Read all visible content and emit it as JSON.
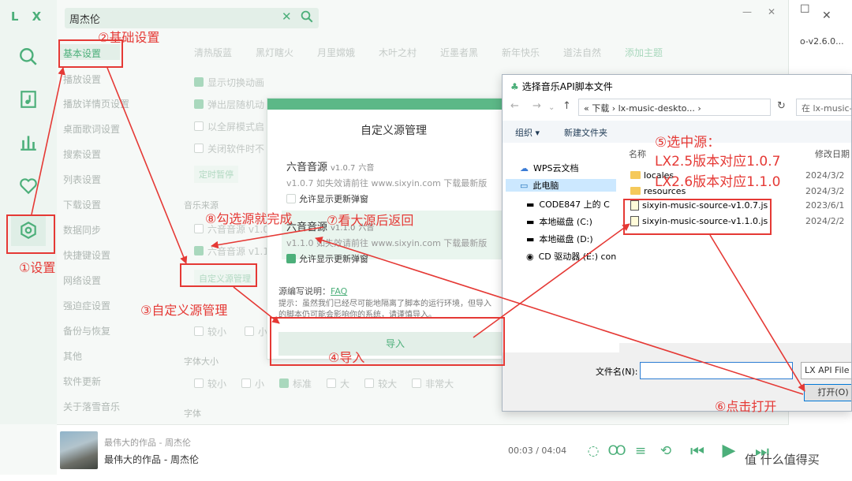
{
  "app": {
    "logo": "L X",
    "search": {
      "value": "周杰伦"
    },
    "window_controls": {
      "minimize": "—",
      "close": "✕"
    }
  },
  "settings_nav": {
    "items": [
      "基本设置",
      "播放设置",
      "播放详情页设置",
      "桌面歌词设置",
      "搜索设置",
      "列表设置",
      "下载设置",
      "数据同步",
      "快捷键设置",
      "网络设置",
      "强迫症设置",
      "备份与恢复",
      "其他",
      "软件更新",
      "关于落雪音乐"
    ]
  },
  "themes": [
    "清热版蓝",
    "黑灯瞎火",
    "月里嫦娥",
    "木叶之村",
    "近墨者黑",
    "新年快乐",
    "道法自然",
    "添加主题"
  ],
  "settings": {
    "show_animation": "显示切换动画",
    "popup_animation": "弹出层随机动",
    "fullscreen": "以全屏模式启",
    "close_tray": "关闭软件时不",
    "timer_pause": "定时暂停",
    "music_source_label": "音乐来源",
    "src_line1": "六音音源 v1.0",
    "src_line2": "六音音源 v1.1",
    "custom_source_btn": "自定义源管理",
    "size_small": "较小",
    "size_tiny": "小",
    "font_size_label": "字体大小",
    "font_opts": [
      "较小",
      "小",
      "标准",
      "大",
      "较大",
      "非常大"
    ],
    "font_label": "字体"
  },
  "player": {
    "track_sub": "最伟大的作品 - 周杰伦",
    "track_main": "最伟大的作品 - 周杰伦",
    "time": "00:03 / 04:04"
  },
  "custom_source_dialog": {
    "title": "自定义源管理",
    "sources": [
      {
        "name": "六音音源",
        "version": "v1.0.7",
        "author": "六音",
        "desc": "v1.0.7 如失效请前往 www.sixyin.com 下载最新版",
        "allow_update": "允许显示更新弹窗"
      },
      {
        "name": "六音音源",
        "version": "v1.1.0",
        "author": "六音",
        "desc": "v1.1.0 如失效请前往 www.sixyin.com 下载最新版",
        "allow_update": "允许显示更新弹窗"
      }
    ],
    "note_label": "源编写说明：",
    "note_link": "FAQ",
    "tip_line1": "提示：虽然我们已经尽可能地隔离了脚本的运行环境，但导入",
    "tip_line2": "的脚本仍可能会影响你的系统，请谨慎导入。",
    "import_label": "导入"
  },
  "file_dialog": {
    "title": "选择音乐API脚本文件",
    "address": "«  下载  ›  lx-music-deskto...  ›",
    "search_placeholder": "在 lx-music-desk",
    "organize": "组织 ▾",
    "new_folder": "新建文件夹",
    "tree": [
      "WPS云文档",
      "此电脑",
      "CODE847 上的 C",
      "本地磁盘 (C:)",
      "本地磁盘 (D:)",
      "CD 驱动器 (E:) con"
    ],
    "col_name": "名称",
    "col_date": "修改日期",
    "files": [
      {
        "name": "locales",
        "date": "2024/3/2",
        "kind": "folder"
      },
      {
        "name": "resources",
        "date": "2024/3/2",
        "kind": "folder"
      },
      {
        "name": "sixyin-music-source-v1.0.7.js",
        "date": "2023/6/1",
        "kind": "js"
      },
      {
        "name": "sixyin-music-source-v1.1.0.js",
        "date": "2024/2/2",
        "kind": "js"
      }
    ],
    "filename_label": "文件名(N):",
    "filetype": "LX API File",
    "open_label": "打开(O)"
  },
  "annotations": {
    "a1": "①设置",
    "a2": "②基础设置",
    "a3": "③自定义源管理",
    "a4": "④导入",
    "a5_line1": "⑤选中源：",
    "a5_line2": "LX2.5版本对应1.0.7",
    "a5_line3": "LX2.6版本对应1.1.0",
    "a6": "⑥点击打开",
    "a7": "⑦看大源后返回",
    "a8": "⑧勾选源就完成"
  },
  "background": {
    "tab_text": "o-v2.6.0...",
    "watermark": "值 什么值得买"
  },
  "colors": {
    "accent": "#4caf7a",
    "annotation": "#e53935"
  }
}
